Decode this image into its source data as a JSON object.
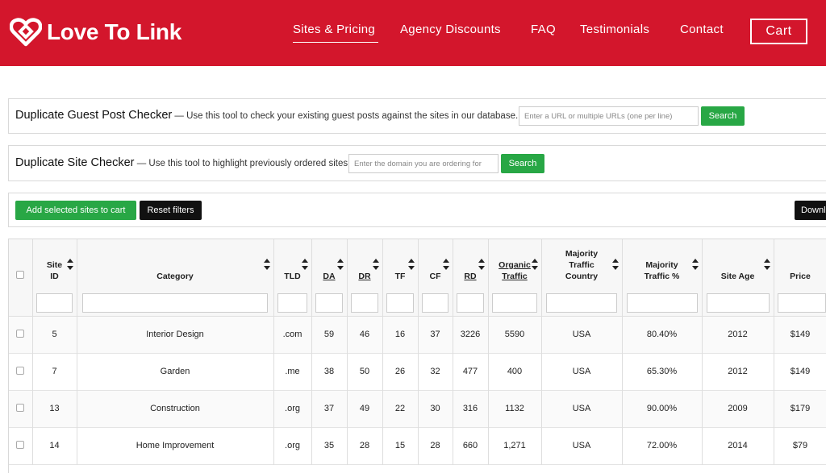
{
  "header": {
    "logo_text": "Love To Link",
    "nav": [
      {
        "label": "Sites & Pricing",
        "active": true
      },
      {
        "label": "Agency Discounts",
        "active": false
      },
      {
        "label": "FAQ",
        "active": false
      },
      {
        "label": "Testimonials",
        "active": false
      },
      {
        "label": "Contact",
        "active": false
      }
    ],
    "cart_label": "Cart",
    "brand_color": "#d3162c"
  },
  "guest_checker": {
    "title": "Duplicate Guest Post Checker",
    "description": " — Use this tool to check your existing guest posts against the sites in our database.",
    "placeholder": "Enter a URL or multiple URLs (one per line)",
    "button": "Search"
  },
  "site_checker": {
    "title": "Duplicate Site Checker",
    "description": " — Use this tool to highlight previously ordered sites.",
    "placeholder": "Enter the domain you are ordering for",
    "button": "Search"
  },
  "actions": {
    "add_to_cart": "Add selected sites to cart",
    "reset_filters": "Reset filters",
    "download": "Downl"
  },
  "table": {
    "columns": [
      {
        "key": "select",
        "label": ""
      },
      {
        "key": "site_id",
        "label": "Site ID"
      },
      {
        "key": "category",
        "label": "Category"
      },
      {
        "key": "tld",
        "label": "TLD"
      },
      {
        "key": "da",
        "label": "DA"
      },
      {
        "key": "dr",
        "label": "DR"
      },
      {
        "key": "tf",
        "label": "TF"
      },
      {
        "key": "cf",
        "label": "CF"
      },
      {
        "key": "rd",
        "label": "RD"
      },
      {
        "key": "organic",
        "label": "Organic Traffic"
      },
      {
        "key": "country",
        "label": "Majority Traffic Country"
      },
      {
        "key": "traffic_pct",
        "label": "Majority Traffic %"
      },
      {
        "key": "age",
        "label": "Site Age"
      },
      {
        "key": "price",
        "label": "Price"
      }
    ],
    "rows": [
      {
        "site_id": "5",
        "category": "Interior Design",
        "tld": ".com",
        "da": "59",
        "dr": "46",
        "tf": "16",
        "cf": "37",
        "rd": "3226",
        "organic": "5590",
        "country": "USA",
        "traffic_pct": "80.40%",
        "age": "2012",
        "price": "$149"
      },
      {
        "site_id": "7",
        "category": "Garden",
        "tld": ".me",
        "da": "38",
        "dr": "50",
        "tf": "26",
        "cf": "32",
        "rd": "477",
        "organic": "400",
        "country": "USA",
        "traffic_pct": "65.30%",
        "age": "2012",
        "price": "$149"
      },
      {
        "site_id": "13",
        "category": "Construction",
        "tld": ".org",
        "da": "37",
        "dr": "49",
        "tf": "22",
        "cf": "30",
        "rd": "316",
        "organic": "1132",
        "country": "USA",
        "traffic_pct": "90.00%",
        "age": "2009",
        "price": "$179"
      },
      {
        "site_id": "14",
        "category": "Home Improvement",
        "tld": ".org",
        "da": "35",
        "dr": "28",
        "tf": "15",
        "cf": "28",
        "rd": "660",
        "organic": "1,271",
        "country": "USA",
        "traffic_pct": "72.00%",
        "age": "2014",
        "price": "$79"
      }
    ]
  }
}
